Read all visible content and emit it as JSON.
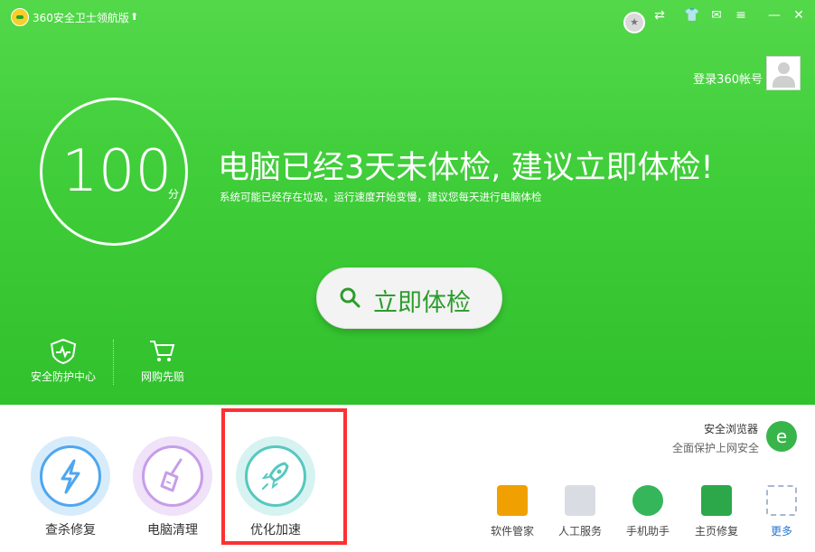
{
  "app": {
    "title": "360安全卫士领航版"
  },
  "titlebar": {
    "icons": [
      "grade-badge-icon",
      "share-icon",
      "skin-icon",
      "feedback-icon",
      "menu-icon",
      "minimize-icon",
      "close-icon"
    ]
  },
  "account": {
    "login_text": "登录360帐号"
  },
  "score": {
    "value": "100",
    "unit": "分"
  },
  "status": {
    "headline": "电脑已经3天未体检, 建议立即体检!",
    "subline": "系统可能已经存在垃圾，运行速度开始变慢，建议您每天进行电脑体检"
  },
  "scan_button": {
    "label": "立即体检"
  },
  "tools": [
    {
      "label": "安全防护中心",
      "icon": "shield-icon"
    },
    {
      "label": "网购先赔",
      "icon": "shopping-cart-icon"
    }
  ],
  "features": [
    {
      "label": "查杀修复",
      "icon": "lightning-icon"
    },
    {
      "label": "电脑清理",
      "icon": "broom-icon"
    },
    {
      "label": "优化加速",
      "icon": "rocket-icon"
    }
  ],
  "browser_promo": {
    "title": "安全浏览器",
    "subtitle": "全面保护上网安全",
    "icon": "browser-icon"
  },
  "quick_apps": [
    {
      "label": "软件管家",
      "icon": "software-manager-icon"
    },
    {
      "label": "人工服务",
      "icon": "customer-service-icon"
    },
    {
      "label": "手机助手",
      "icon": "phone-assistant-icon"
    },
    {
      "label": "主页修复",
      "icon": "home-repair-icon"
    },
    {
      "label": "更多",
      "icon": "more-icon"
    }
  ],
  "colors": {
    "header_green": "#3fcd39",
    "scan_text": "#2c9c2c",
    "highlight": "#ff3030"
  }
}
